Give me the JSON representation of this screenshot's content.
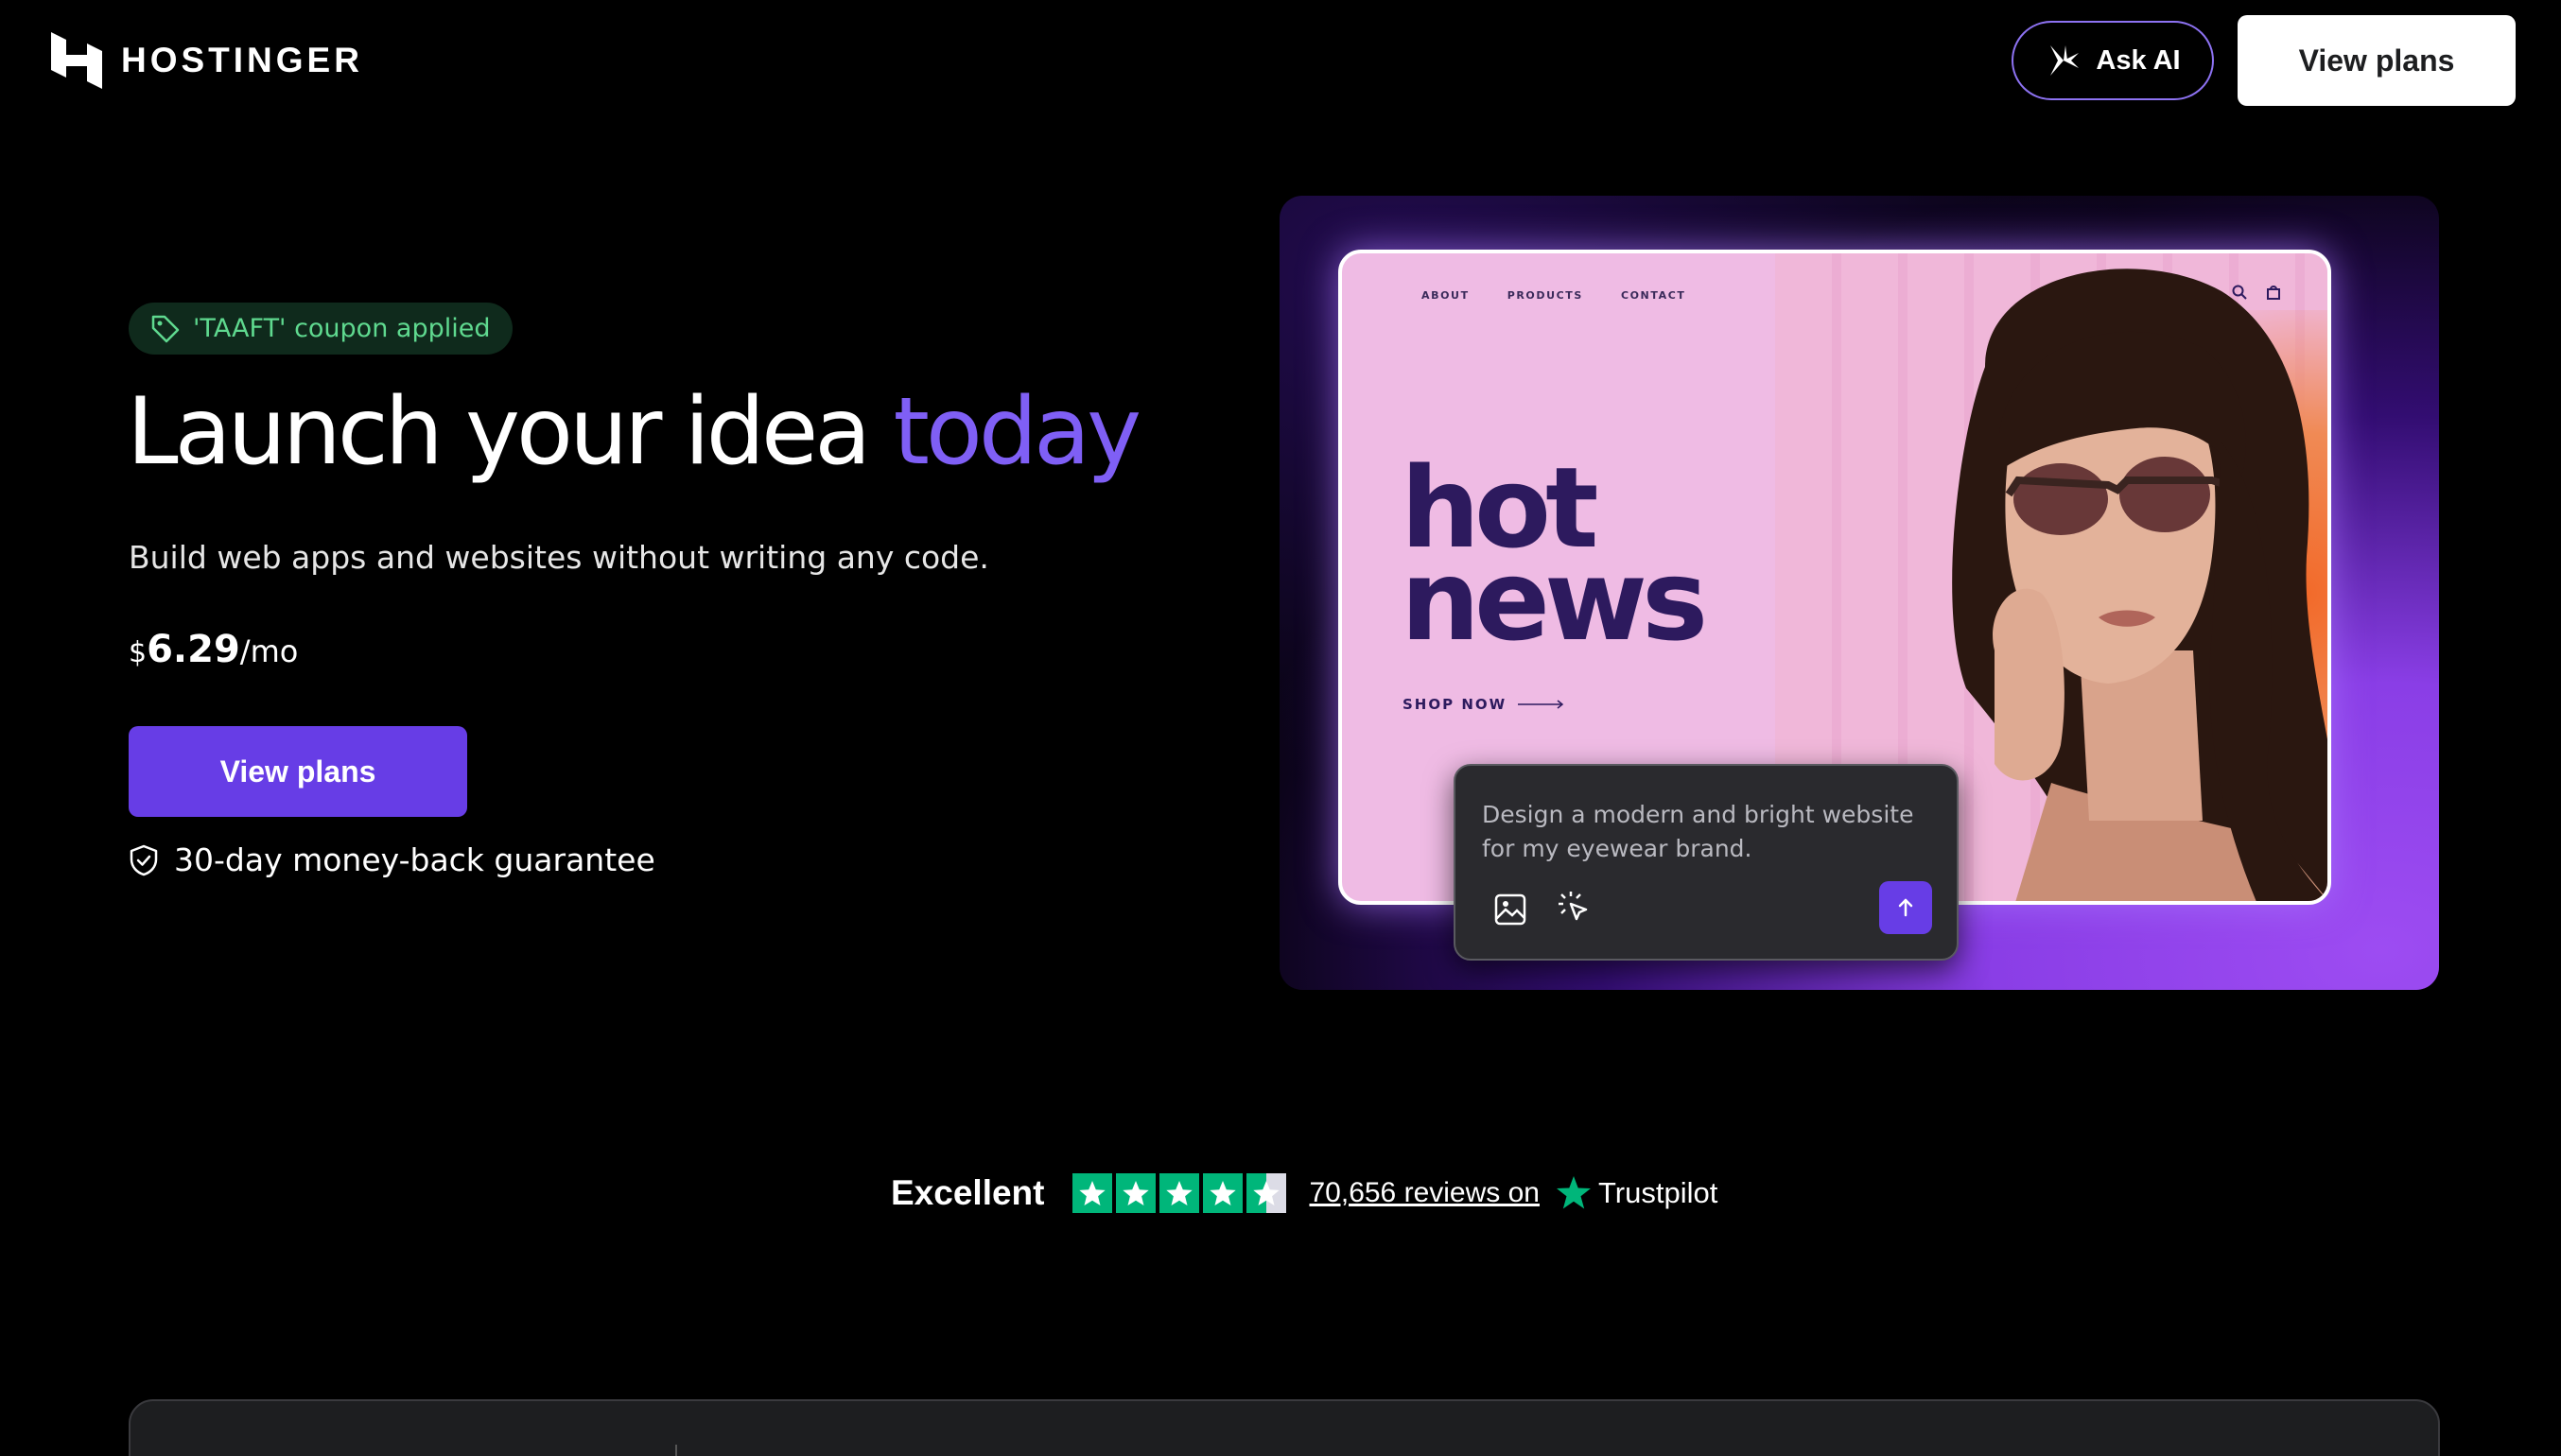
{
  "header": {
    "brand": "HOSTINGER",
    "ask_ai_label": "Ask AI",
    "view_plans_label": "View plans"
  },
  "hero": {
    "coupon_text": "'TAAFT' coupon applied",
    "headline_main": "Launch your idea ",
    "headline_accent": "today",
    "subtitle": "Build web apps and websites without writing any code.",
    "price": {
      "currency": "$",
      "amount": "6.29",
      "period": "/mo"
    },
    "cta_label": "View plans",
    "guarantee": "30-day money-back guarantee"
  },
  "preview": {
    "nav": [
      "ABOUT",
      "PRODUCTS",
      "CONTACT"
    ],
    "title_line1": "hot",
    "title_line2": "news",
    "shop_now": "SHOP NOW",
    "prompt_text": "Design a modern and bright website for my eyewear brand."
  },
  "trustpilot": {
    "rating_word": "Excellent",
    "reviews": "70,656 reviews on",
    "brand": "Trustpilot",
    "stars": 4.5
  },
  "colors": {
    "accent": "#673de6",
    "accent_text": "#7f5ff5",
    "coupon_green": "#5fd98f",
    "trustpilot_green": "#00b67a"
  }
}
